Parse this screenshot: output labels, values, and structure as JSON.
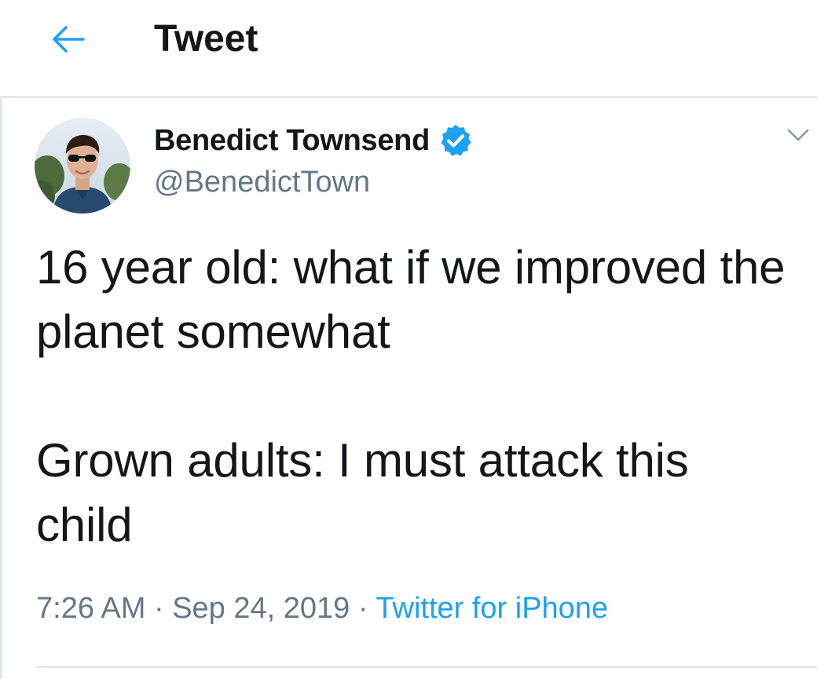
{
  "header": {
    "title": "Tweet",
    "back_icon": "arrow-left-icon"
  },
  "colors": {
    "accent": "#1da1f2",
    "text_primary": "#14171a",
    "text_secondary": "#657786",
    "divider": "#e1e8ed"
  },
  "author": {
    "display_name": "Benedict Townsend",
    "handle": "@BenedictTown",
    "verified": true,
    "verified_icon": "verified-badge-icon",
    "avatar_icon": "avatar-photo"
  },
  "menu_icon": "chevron-down-icon",
  "tweet": {
    "text": "16 year old: what if we improved the planet somewhat\n\nGrown adults: I must attack this child",
    "time": "7:26 AM",
    "date": "Sep 24, 2019",
    "separator": "·",
    "source": "Twitter for iPhone"
  }
}
